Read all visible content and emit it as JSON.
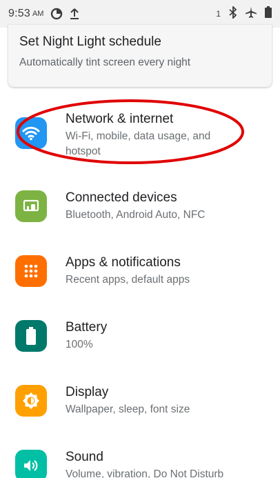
{
  "status_bar": {
    "time": "9:53",
    "ampm": "AM",
    "notif_count": "1"
  },
  "night_light": {
    "title": "Set Night Light schedule",
    "subtitle": "Automatically tint screen every night"
  },
  "settings": [
    {
      "title": "Network & internet",
      "subtitle": "Wi-Fi, mobile, data usage, and hotspot",
      "icon": "wifi-icon",
      "color": "#2196f3"
    },
    {
      "title": "Connected devices",
      "subtitle": "Bluetooth, Android Auto, NFC",
      "icon": "devices-icon",
      "color": "#7cb342"
    },
    {
      "title": "Apps & notifications",
      "subtitle": "Recent apps, default apps",
      "icon": "apps-icon",
      "color": "#ff6f00"
    },
    {
      "title": "Battery",
      "subtitle": "100%",
      "icon": "battery-icon",
      "color": "#00796b"
    },
    {
      "title": "Display",
      "subtitle": "Wallpaper, sleep, font size",
      "icon": "brightness-icon",
      "color": "#ffa000"
    },
    {
      "title": "Sound",
      "subtitle": "Volume, vibration, Do Not Disturb",
      "icon": "volume-icon",
      "color": "#00bfa5"
    }
  ],
  "annotation": {
    "color": "#e00000"
  }
}
